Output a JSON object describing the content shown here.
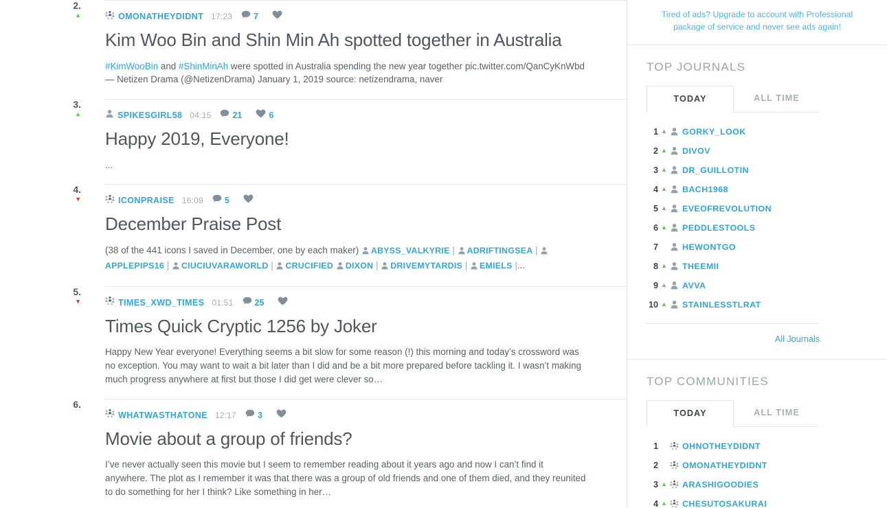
{
  "scroll_top_button": {
    "icon": "arrow-up-icon"
  },
  "entries": [
    {
      "rank": "2.",
      "trend": "up",
      "author": "OMONATHEYDIDNT",
      "author_icon": "community-icon",
      "time": "17:23",
      "comments": "7",
      "likes": "",
      "title": "Kim Woo Bin and Shin Min Ah spotted together in Australia",
      "snippet_html": "<a data-name=\"hashtag-link\" data-interactable=\"true\">#KimWooBin</a> and <a data-name=\"hashtag-link\" data-interactable=\"true\">#ShinMinAh</a> were spotted in Australia spending the new year together pic.twitter.com/QanCyKnWbd— Netizen Drama (@NetizenDrama) January 1, 2019 source: netizendrama, naver"
    },
    {
      "rank": "3.",
      "trend": "up",
      "author": "SPIKESGIRL58",
      "author_icon": "user-icon",
      "time": "04:15",
      "comments": "21",
      "likes": "6",
      "title": "Happy 2019, Everyone!",
      "snippet_html": "..."
    },
    {
      "rank": "4.",
      "trend": "down",
      "author": "ICONPRAISE",
      "author_icon": "community-icon",
      "time": "16:09",
      "comments": "5",
      "likes": "",
      "title": "December Praise Post",
      "snippet_html": "(38 of the 441 icons I saved in December, one by each maker) <span class=\"uname\" data-name=\"user-link\" data-interactable=\"true\">ABYSS_VALKYRIE</span> <span class=\"sep\">|</span> <span class=\"uname\" data-name=\"user-link\" data-interactable=\"true\">ADRIFTINGSEA</span> <span class=\"sep\">|</span> <span class=\"uname\" data-name=\"user-link\" data-interactable=\"true\">APPLEPIPS16</span> <span class=\"sep\">|</span> <span class=\"uname\" data-name=\"user-link\" data-interactable=\"true\">CIUCIUVARAWORLD</span> <span class=\"sep\">|</span> <span class=\"uname\" data-name=\"user-link\" data-interactable=\"true\">CRUCIFIED</span> <span class=\"uname\" data-name=\"user-link\" data-interactable=\"true\">DIXON</span> <span class=\"sep\">|</span> <span class=\"uname\" data-name=\"user-link\" data-interactable=\"true\">DRIVEMYTARDIS</span> <span class=\"sep\">|</span> <span class=\"uname\" data-name=\"user-link\" data-interactable=\"true\">EMIELS</span> <span class=\"sep\">|</span>..."
    },
    {
      "rank": "5.",
      "trend": "down",
      "author": "TIMES_XWD_TIMES",
      "author_icon": "community-icon",
      "time": "01:51",
      "comments": "25",
      "likes": "",
      "title": "Times Quick Cryptic 1256 by Joker",
      "snippet_html": "Happy New Year everyone! Everything seems a bit slow for some reason (!) this morning and today’s crossword was no exception. You may want to wait a bit later than I did and be a bit more prepared before tackling it. I wasn’t making much progress anywhere at first but those I did get were clever so…"
    },
    {
      "rank": "6.",
      "trend": "none",
      "author": "WHATWASTHATONE",
      "author_icon": "community-icon",
      "time": "12:17",
      "comments": "3",
      "likes": "",
      "title": "Movie about a group of friends?",
      "snippet_html": "I’ve never actually seen this movie but I seem to remember reading about it years ago and now I can’t find it anywhere. The plot as I remember it was that there was a group of old friends and one of them died, and they reunited to do something for her I think? Like something in her…"
    }
  ],
  "sidebar": {
    "ad": {
      "text": "Tired of ads? Upgrade to account with Professional package of service and never see ads again!"
    },
    "top_journals": {
      "title": "TOP JOURNALS",
      "tabs": [
        {
          "label": "TODAY",
          "active": true
        },
        {
          "label": "ALL TIME",
          "active": false
        }
      ],
      "rows": [
        {
          "rank": "1",
          "change": "up",
          "name": "GORKY_LOOK",
          "icon": "user-icon"
        },
        {
          "rank": "2",
          "change": "up",
          "name": "DIVOV",
          "icon": "user-icon"
        },
        {
          "rank": "3",
          "change": "up",
          "name": "DR_GUILLOTIN",
          "icon": "user-icon"
        },
        {
          "rank": "4",
          "change": "up",
          "name": "BACH1968",
          "icon": "user-icon"
        },
        {
          "rank": "5",
          "change": "up",
          "name": "EVEOFREVOLUTION",
          "icon": "user-icon"
        },
        {
          "rank": "6",
          "change": "up",
          "name": "PEDDLESTOOLS",
          "icon": "user-icon"
        },
        {
          "rank": "7",
          "change": "none",
          "name": "HEWONTGO",
          "icon": "user-icon"
        },
        {
          "rank": "8",
          "change": "up",
          "name": "THEEMII",
          "icon": "user-icon"
        },
        {
          "rank": "9",
          "change": "up",
          "name": "AVVA",
          "icon": "user-icon"
        },
        {
          "rank": "10",
          "change": "up",
          "name": "STAINLESSTLRAT",
          "icon": "user-icon"
        }
      ],
      "all_link": "All Journals"
    },
    "top_communities": {
      "title": "TOP COMMUNITIES",
      "tabs": [
        {
          "label": "TODAY",
          "active": true
        },
        {
          "label": "ALL TIME",
          "active": false
        }
      ],
      "rows": [
        {
          "rank": "1",
          "change": "none",
          "name": "OHNOTHEYDIDNT",
          "icon": "community-icon"
        },
        {
          "rank": "2",
          "change": "none",
          "name": "OMONATHEYDIDNT",
          "icon": "community-icon"
        },
        {
          "rank": "3",
          "change": "up",
          "name": "ARASHIGOODIES",
          "icon": "community-icon"
        },
        {
          "rank": "4",
          "change": "up",
          "name": "CHESUTOSAKURAI",
          "icon": "community-icon"
        }
      ]
    }
  },
  "colors": {
    "link": "#2ca7e0",
    "ad_link": "#49b8e8",
    "up_arrow": "#5cc94d",
    "down_arrow": "#e8362a",
    "title_text": "#4c585f",
    "muted": "#9fb0b8"
  }
}
